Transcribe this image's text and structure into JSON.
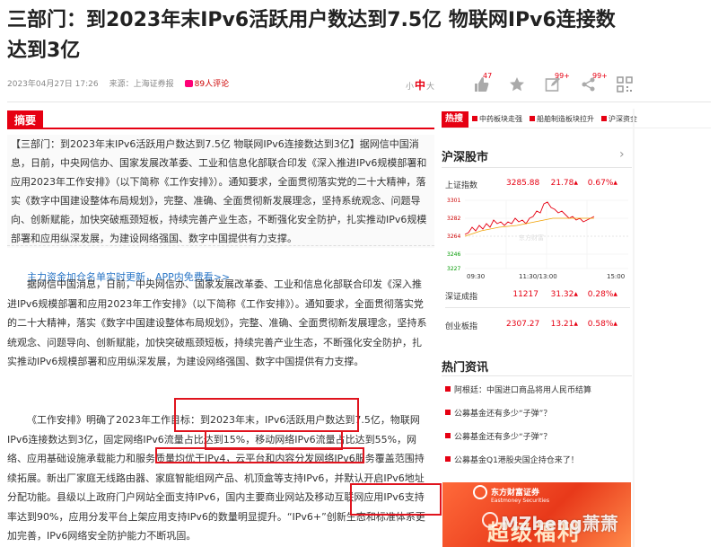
{
  "article": {
    "title": "三部门：到2023年末IPv6活跃用户数达到7.5亿 物联网IPv6连接数达到3亿",
    "date": "2023年04月27日 17:26",
    "source": "来源：上海证券报",
    "comments": "89人评论",
    "font_sizes": [
      "小",
      "中",
      "大"
    ],
    "abstract_label": "摘要",
    "abstract_text": "【三部门：到2023年末IPv6活跃用户数达到7.5亿 物联网IPv6连接数达到3亿】据网信中国消息，日前，中央网信办、国家发展改革委、工业和信息化部联合印发《深入推进IPv6规模部署和应用2023年工作安排》（以下简称《工作安排》）。通知要求，全面贯彻落实党的二十大精神，落实《数字中国建设整体布局规划》，完整、准确、全面贯彻新发展理念，坚持系统观念、问题导向、创新赋能，加快突破瓶颈短板，持续完善产业生态，不断强化安全防护，扎实推动IPv6规模部署和应用纵深发展，为建设网络强国、数字中国提供有力支撑。",
    "promo_link": "主力资金加仓名单实时更新，APP内免费看>>",
    "para1": "据网信中国消息，日前，中央网信办、国家发展改革委、工业和信息化部联合印发《深入推进IPv6规模部署和应用2023年工作安排》（以下简称《工作安排》）。通知要求，全面贯彻落实党的二十大精神，落实《数字中国建设整体布局规划》，完整、准确、全面贯彻新发展理念，坚持系统观念、问题导向、创新赋能，加快突破瓶颈短板，持续完善产业生态，不断强化安全防护，扎实推动IPv6规模部署和应用纵深发展，为建设网络强国、数字中国提供有力支撑。",
    "para2": "《工作安排》明确了2023年工作目标：到2023年末，IPv6活跃用户数达到7.5亿，物联网IPv6连接数达到3亿，固定网络IPv6流量占比达到15%，移动网络IPv6流量占比达到55%，网络、应用基础设施承载能力和服务质量均优于IPv4，云平台和内容分发网络IPv6服务覆盖范围持续拓展。新出厂家庭无线路由器、家庭智能组网产品、机顶盒等支持IPv6，并默认开启IPv6地址分配功能。县级以上政府门户网站全面支持IPv6，国内主要商业网站及移动互联网应用IPv6支持率达到90%，应用分发平台上架应用支持IPv6的数量明显提升。“IPv6+”创新生态和标准体系更加完善，IPv6网络安全防护能力不断巩固。"
  },
  "actions": {
    "like_count": "47",
    "comment_count": "99+"
  },
  "hot_bar": {
    "label": "热搜",
    "items": [
      "中药板块走强",
      "船舶制造板块拉升",
      "沪深资金"
    ]
  },
  "market": {
    "title": "沪深股市",
    "rows": [
      {
        "name": "上证指数",
        "value": "3285.88",
        "change": "21.78",
        "pct": "0.67%"
      },
      {
        "name": "深证成指",
        "value": "11217",
        "change": "31.32",
        "pct": "0.28%"
      },
      {
        "name": "创业板指",
        "value": "2307.27",
        "change": "13.21",
        "pct": "0.58%"
      }
    ],
    "chart_yticks": [
      "3301",
      "3282",
      "3264",
      "3246",
      "3227"
    ],
    "chart_xticks": [
      "09:30",
      "11:30/13:00",
      "15:00"
    ],
    "chart_watermark": "东方财富"
  },
  "hot_news": {
    "title": "热门资讯",
    "items": [
      "阿根廷：中国进口商品将用人民币结算",
      "公募基金还有多少“子弹”？",
      "公募基金还有多少“子弹”？",
      "公募基金Q1港股央国企持仓来了！"
    ]
  },
  "ad": {
    "brand": "东方财富证券",
    "brand_en": "Eastmoney Securities",
    "slogan": "超级福利"
  },
  "watermark": "MZheng萧萧",
  "colors": {
    "accent": "#e60012",
    "link": "#2a76c6",
    "highlight_box": "#e0141e"
  }
}
